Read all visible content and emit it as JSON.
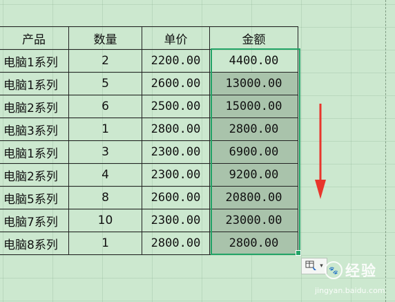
{
  "table": {
    "headers": [
      "产品",
      "数量",
      "单价",
      "金额"
    ],
    "rows": [
      {
        "product": "电脑1系列",
        "qty": "2",
        "price": "2200.00",
        "amount": "4400.00"
      },
      {
        "product": "电脑1系列",
        "qty": "5",
        "price": "2600.00",
        "amount": "13000.00"
      },
      {
        "product": "电脑2系列",
        "qty": "6",
        "price": "2500.00",
        "amount": "15000.00"
      },
      {
        "product": "电脑3系列",
        "qty": "1",
        "price": "2800.00",
        "amount": "2800.00"
      },
      {
        "product": "电脑1系列",
        "qty": "3",
        "price": "2300.00",
        "amount": "6900.00"
      },
      {
        "product": "电脑2系列",
        "qty": "4",
        "price": "2300.00",
        "amount": "9200.00"
      },
      {
        "product": "电脑5系列",
        "qty": "8",
        "price": "2600.00",
        "amount": "20800.00"
      },
      {
        "product": "电脑7系列",
        "qty": "10",
        "price": "2300.00",
        "amount": "23000.00"
      },
      {
        "product": "电脑8系列",
        "qty": "1",
        "price": "2800.00",
        "amount": "2800.00"
      }
    ]
  },
  "annotation": {
    "arrow_color": "#e8352b",
    "direction": "down"
  },
  "selection": {
    "border_color": "#21a366",
    "fill_color": "#a9c3ab"
  },
  "quick_analysis": {
    "icon": "quick-analysis-icon"
  },
  "watermark": {
    "brand": "Bai",
    "name": "经验",
    "url": "jingyan.baidu.com"
  }
}
